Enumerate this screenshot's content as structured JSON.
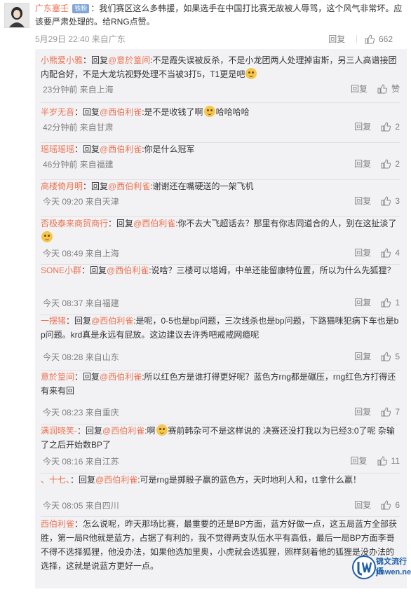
{
  "comment": {
    "username": "广东塞壬",
    "badge": "铁粉",
    "text": "：我们赛区这么多韩援，如果选手在中国打比赛无故被人辱骂，这个风气非常坏。应该要严肃处理的。给RNG点赞。",
    "time": "5月29日 22:40 来自广东",
    "reply_label": "回复",
    "likes": "662"
  },
  "replies": [
    {
      "user": "小熊爱小雅",
      "pre": "：回复",
      "mention": "@意於篁间",
      "text": ":不是霞失误被反杀，不是小龙团两人处理掉宙斯，另三人高谱接团内配合好，不是大龙坑视野处理不当被3打5，T1更是吧",
      "emoji": true,
      "after": "",
      "time": "23分钟前 来自上海",
      "reply": "回复",
      "likes": "赞"
    },
    {
      "user": "半岁无音",
      "pre": "：回复",
      "mention": "@西伯利雀",
      "text": ":是不是收钱了啊",
      "emoji": true,
      "after": "哈哈哈哈",
      "time": "42分钟前 来自甘肃",
      "reply": "回复",
      "likes": "2"
    },
    {
      "user": "瑶瑶瑶瑶",
      "pre": "：回复",
      "mention": "@西伯利雀",
      "text": ":你是什么冠军",
      "emoji": false,
      "after": "",
      "time": "46分钟前 来自福建",
      "reply": "回复",
      "likes": "2"
    },
    {
      "user": "高楼倚月明",
      "pre": "：回复",
      "mention": "@西伯利雀",
      "text": ":谢谢还在嘴硬送的一架飞机",
      "emoji": false,
      "after": "",
      "time": "今天 09:20 来自天津",
      "reply": "回复",
      "likes": "3"
    },
    {
      "user": "否极泰来商贸商行",
      "pre": "：回复",
      "mention": "@西伯利雀",
      "text": ":你不去大飞超话去？那里有你志同道合的人，别在这扯淡了",
      "emoji": true,
      "after": "",
      "time": "今天 08:49 来自上海",
      "reply": "回复",
      "likes": "4"
    },
    {
      "user": "SONE小群",
      "pre": "：回复",
      "mention": "@西伯利雀",
      "text": ":说啥？三楼可以塔姆，中单还能留康特位置，所以为什么先狐狸？",
      "emoji": false,
      "after": "",
      "time": "今天 08:37 来自福建",
      "reply": "回复",
      "likes": "1"
    },
    {
      "user": "一摆猪",
      "pre": "：回复",
      "mention": "@西伯利雀",
      "text": ":是呢，0-5也是bp问题，三次线杀也是bp问题，下路猫咪犯病下车也是bp问题。krd真是永远有屁放。这边建议去许秀吧戒戒网瘾呢",
      "emoji": false,
      "after": "",
      "time": "今天 08:28 来自山东",
      "reply": "回复",
      "likes": "5"
    },
    {
      "user": "意於篁间",
      "pre": "：回复",
      "mention": "@西伯利雀",
      "text": ":所以红色方是谁打得更好呢？蓝色方rng都是碾压，rng红色方打得还有来有回",
      "emoji": false,
      "after": "",
      "time": "今天 08:23 来自重庆",
      "reply": "回复",
      "likes": "7"
    },
    {
      "user": "满润晓笑-",
      "pre": "：回复",
      "mention": "@西伯利雀",
      "text": ":啊",
      "emoji": true,
      "after": "赛前韩杂可不是这样说的 决赛还没打我以为已经3:0了呢 杂输了之后开始数BP了",
      "time": "今天 08:16 来自江苏",
      "reply": "回复",
      "likes": "11"
    },
    {
      "user": "、十七、",
      "pre": "：回复",
      "mention": "@西伯利雀",
      "text": ":可是rng是掷骰子赢的蓝色方，天时地利人和，t1拿什么赢！",
      "emoji": false,
      "after": "",
      "time": "今天 08:05 来自四川",
      "reply": "回复",
      "likes": "6"
    },
    {
      "user": "西伯利雀",
      "pre": "：",
      "mention": "",
      "text": "怎么说呢，昨天那场比赛，最重要的还是BP方面，蓝方好做一点，这五局蓝方全部获胜，第一局R他就是蓝方，占据了有利的，我不觉得两支队伍水平有高低，最后一局BP方面李哥不得不选择狐狸，他没办法，如果他选加里奥，小虎就会选狐狸，照样刻着他的狐狸是没办法的选择，这就是说蓝方更好一点。",
      "emoji": false,
      "after": "",
      "time": "",
      "reply": "",
      "likes": ""
    }
  ],
  "watermark": {
    "line1": "锦文流行语",
    "line2": "jinwen.net"
  },
  "colors": {
    "accent": "#eb7350",
    "bg_replies": "#f2f2f5"
  }
}
